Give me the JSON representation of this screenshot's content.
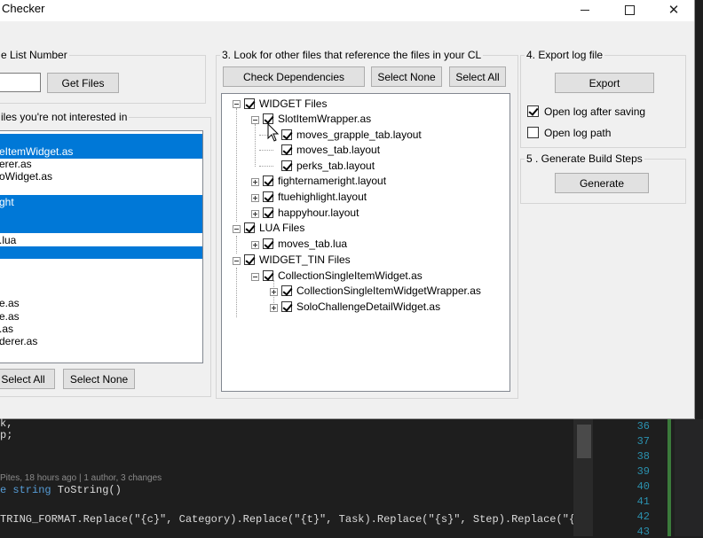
{
  "window": {
    "title": "Checker",
    "minimize_icon": "minimize-icon",
    "maximize_icon": "maximize-icon",
    "close_icon": "close-icon"
  },
  "section1": {
    "legend": "e List Number",
    "input_value": "",
    "get_files_label": "Get Files"
  },
  "section2": {
    "legend": "iles you're not interested in",
    "items": [
      {
        "label": "eItemWidget.as",
        "selected": true
      },
      {
        "label": "erer.as",
        "selected": false
      },
      {
        "label": "oWidget.as",
        "selected": false
      },
      {
        "label": "ght",
        "selected": true
      },
      {
        "label": ".lua",
        "selected": false
      },
      {
        "label": "e.as",
        "selected": false
      },
      {
        "label": "e.as",
        "selected": false
      },
      {
        "label": ".as",
        "selected": false
      },
      {
        "label": "derer.as",
        "selected": false
      }
    ],
    "select_all_label": "Select All",
    "select_none_label": "Select None"
  },
  "section3": {
    "legend": "3. Look for other files that reference the files in your CL",
    "check_dependencies_label": "Check Dependencies",
    "select_none_label": "Select None",
    "select_all_label": "Select All",
    "tree": [
      {
        "label": "WIDGET Files",
        "checked": true,
        "expander": "minus"
      },
      {
        "label": "SlotItemWrapper.as",
        "checked": true,
        "expander": "minus"
      },
      {
        "label": "moves_grapple_tab.layout",
        "checked": true,
        "expander": ""
      },
      {
        "label": "moves_tab.layout",
        "checked": true,
        "expander": ""
      },
      {
        "label": "perks_tab.layout",
        "checked": true,
        "expander": ""
      },
      {
        "label": "fighternameright.layout",
        "checked": true,
        "expander": "plus"
      },
      {
        "label": "ftuehighlight.layout",
        "checked": true,
        "expander": "plus"
      },
      {
        "label": "happyhour.layout",
        "checked": true,
        "expander": "plus"
      },
      {
        "label": "LUA Files",
        "checked": true,
        "expander": "minus"
      },
      {
        "label": "moves_tab.lua",
        "checked": true,
        "expander": "plus"
      },
      {
        "label": "WIDGET_TIN Files",
        "checked": true,
        "expander": "minus"
      },
      {
        "label": "CollectionSingleItemWidget.as",
        "checked": true,
        "expander": "minus"
      },
      {
        "label": "CollectionSingleItemWidgetWrapper.as",
        "checked": true,
        "expander": "plus"
      },
      {
        "label": "SoloChallengeDetailWidget.as",
        "checked": true,
        "expander": "plus"
      }
    ]
  },
  "section4": {
    "legend": "4. Export log file",
    "export_label": "Export",
    "open_after_saving_label": "Open log after saving",
    "open_after_saving_checked": true,
    "open_log_path_label": "Open log path",
    "open_log_path_checked": false
  },
  "section5": {
    "legend": "5 . Generate Build Steps",
    "generate_label": "Generate"
  },
  "editor": {
    "line1": "k,",
    "line2": "p;",
    "codelens": "Pites, 18 hours ago | 1 author, 3 changes",
    "line4_kw": "e string",
    "line4_fn": " ToString()",
    "line5": "TRING_FORMAT.Replace(\"{c}\", Category).Replace(\"{t}\", Task).Replace(\"{s}\", Step).Replace(\"{i",
    "line_numbers": [
      "36",
      "37",
      "38",
      "39",
      "40",
      "41",
      "42",
      "43"
    ]
  }
}
